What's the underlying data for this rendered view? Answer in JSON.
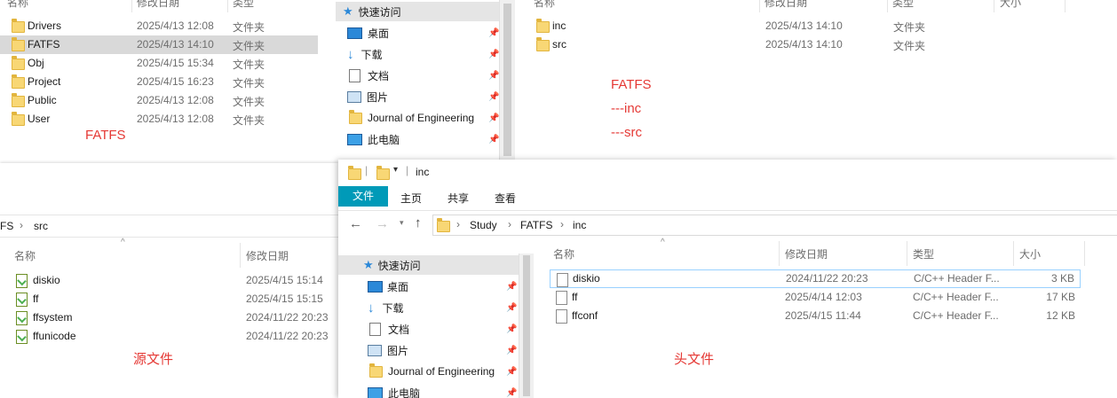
{
  "colors": {
    "accent": "#0078d7",
    "file_tab": "#009ab8",
    "annotation": "#e53935",
    "folder": "#f8d775"
  },
  "tl": {
    "headers": {
      "name": "名称",
      "date": "修改日期",
      "type": "类型"
    },
    "rows": [
      {
        "name": "Drivers",
        "date": "2025/4/13 12:08",
        "type": "文件夹"
      },
      {
        "name": "FATFS",
        "date": "2025/4/13 14:10",
        "type": "文件夹"
      },
      {
        "name": "Obj",
        "date": "2025/4/15 15:34",
        "type": "文件夹"
      },
      {
        "name": "Project",
        "date": "2025/4/15 16:23",
        "type": "文件夹"
      },
      {
        "name": "Public",
        "date": "2025/4/13 12:08",
        "type": "文件夹"
      },
      {
        "name": "User",
        "date": "2025/4/13 12:08",
        "type": "文件夹"
      }
    ],
    "annotation": "FATFS"
  },
  "nav_top": {
    "items": [
      {
        "label": "快速访问"
      },
      {
        "label": "桌面"
      },
      {
        "label": "下载"
      },
      {
        "label": "文档"
      },
      {
        "label": "图片"
      },
      {
        "label": "Journal of Engineering"
      },
      {
        "label": "此电脑"
      }
    ]
  },
  "tr": {
    "headers": {
      "name": "名称",
      "date": "修改日期",
      "type": "类型",
      "size": "大小"
    },
    "rows": [
      {
        "name": "inc",
        "date": "2025/4/13 14:10",
        "type": "文件夹"
      },
      {
        "name": "src",
        "date": "2025/4/13 14:10",
        "type": "文件夹"
      }
    ],
    "annotation": {
      "line1": "FATFS",
      "line2": "---inc",
      "line3": "---src"
    }
  },
  "bl": {
    "breadcrumb": {
      "prev": "FS",
      "current": "src"
    },
    "headers": {
      "name": "名称",
      "date": "修改日期"
    },
    "rows": [
      {
        "name": "diskio",
        "date": "2025/4/15 15:14"
      },
      {
        "name": "ff",
        "date": "2025/4/15 15:15"
      },
      {
        "name": "ffsystem",
        "date": "2024/11/22 20:23"
      },
      {
        "name": "ffunicode",
        "date": "2024/11/22 20:23"
      }
    ],
    "annotation": "源文件"
  },
  "br": {
    "title": "inc",
    "ribbon": {
      "file": "文件",
      "home": "主页",
      "share": "共享",
      "view": "查看"
    },
    "breadcrumb": {
      "study": "Study",
      "fatfs": "FATFS",
      "inc": "inc"
    },
    "headers": {
      "name": "名称",
      "date": "修改日期",
      "type": "类型",
      "size": "大小"
    },
    "rows": [
      {
        "name": "diskio",
        "date": "2024/11/22 20:23",
        "type": "C/C++ Header F...",
        "size": "3 KB"
      },
      {
        "name": "ff",
        "date": "2025/4/14 12:03",
        "type": "C/C++ Header F...",
        "size": "17 KB"
      },
      {
        "name": "ffconf",
        "date": "2025/4/15 11:44",
        "type": "C/C++ Header F...",
        "size": "12 KB"
      }
    ],
    "nav": {
      "items": [
        {
          "label": "快速访问"
        },
        {
          "label": "桌面"
        },
        {
          "label": "下载"
        },
        {
          "label": "文档"
        },
        {
          "label": "图片"
        },
        {
          "label": "Journal of Engineering"
        },
        {
          "label": "此电脑"
        }
      ]
    },
    "annotation": "头文件"
  }
}
